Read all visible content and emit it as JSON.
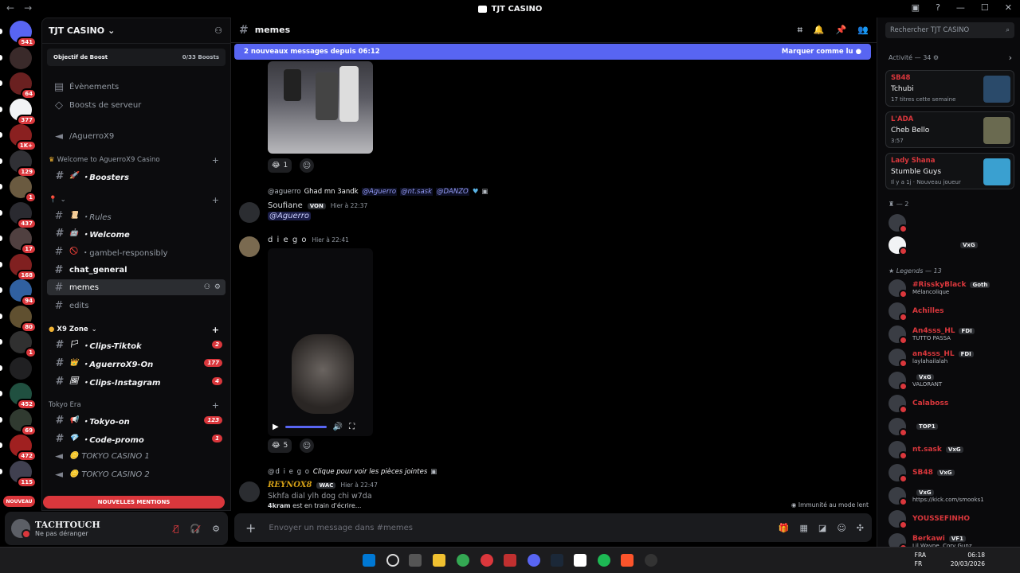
{
  "window": {
    "title": "TJT CASINO",
    "nav_back": "←",
    "nav_fwd": "→"
  },
  "rail": {
    "servers": [
      {
        "badge": "541"
      },
      {
        "badge": ""
      },
      {
        "badge": "64"
      },
      {
        "badge": "377"
      },
      {
        "badge": "1K+"
      },
      {
        "badge": "129"
      },
      {
        "badge": "1"
      },
      {
        "badge": "437"
      },
      {
        "badge": "17"
      },
      {
        "badge": "168"
      },
      {
        "badge": "94"
      },
      {
        "badge": "80"
      },
      {
        "badge": "1"
      },
      {
        "badge": ""
      },
      {
        "badge": "452"
      },
      {
        "badge": "69"
      },
      {
        "badge": "472"
      },
      {
        "badge": "115"
      }
    ],
    "new_label": "NOUVEAU"
  },
  "server": {
    "name": "TJT CASINO",
    "boost_goal": "Objectif de Boost",
    "boost_count": "0/33 Boosts",
    "events": "Évènements",
    "boosts": "Boosts de serveur",
    "voice_top": "/AguerroX9",
    "cat1": "Welcome to AguerroX9 Casino",
    "ch_boosters": "・Boosters",
    "ch_rules": "・Rules",
    "ch_welcome": "・Welcome",
    "ch_gambel": "・gambel-responsibly",
    "ch_chat_general": "chat_general",
    "ch_memes": "memes",
    "ch_edits": "edits",
    "cat2": "X9 Zone",
    "ch_clips_tiktok": "・Clips-Tiktok",
    "ch_clips_tiktok_cnt": "2",
    "ch_aguerro_on": "・AguerroX9-On",
    "ch_aguerro_on_cnt": "177",
    "ch_clips_insta": "・Clips-Instagram",
    "ch_clips_insta_cnt": "4",
    "cat3": "Tokyo Era",
    "ch_tokyo_on": "・Tokyo-on",
    "ch_tokyo_on_cnt": "123",
    "ch_code_promo": "・Code-promo",
    "ch_code_promo_cnt": "1",
    "ch_voice1": "TOKYO CASINO 1",
    "ch_voice2": "TOKYO CASINO 2",
    "new_mentions": "NOUVELLES MENTIONS"
  },
  "user": {
    "name": "TACHTOUCH",
    "status": "Ne pas déranger"
  },
  "chat": {
    "channel": "memes",
    "new_messages": "2 nouveaux messages depuis 06:12",
    "mark_read": "Marquer comme lu",
    "react1_count": "1",
    "reply1_user": "@aguerro",
    "reply1_text": "Ghad mn 3andk",
    "reply1_m1": "@Aguerro",
    "reply1_m2": "@nt.sask",
    "reply1_m3": "@DANZO",
    "msg1_author": "Soufiane",
    "msg1_tag": "VON",
    "msg1_time": "Hier à 22:37",
    "msg1_mention": "@Aguerro",
    "msg2_author": "d i e g o",
    "msg2_time": "Hier à 22:41",
    "react2_count": "5",
    "reply2_user": "@d i e g o",
    "reply2_text": "Clique pour voir les pièces jointes",
    "msg3_author": "REYNOX8",
    "msg3_tag": "WAC",
    "msg3_time": "Hier à 22:47",
    "msg3_text": "Skhfa dial ylh dog chi w7da",
    "typing_user": "4kram",
    "typing_text": "est en train d'écrire...",
    "slow_mode": "Immunité au mode lent",
    "composer_placeholder": "Envoyer un message dans #memes"
  },
  "members": {
    "search_placeholder": "Rechercher TJT CASINO",
    "activity_label": "Activité — 34",
    "activities": [
      {
        "user": "SB48",
        "game": "Tchubi",
        "sub": "17 titres cette semaine",
        "color": "#2a4a6a"
      },
      {
        "user": "L'ADA",
        "game": "Cheb Bello",
        "sub": "3:57",
        "color": "#6a6a50"
      },
      {
        "user": "Lady Shana",
        "game": "Stumble Guys",
        "sub": "Il y a 1j · Nouveau joueur",
        "color": "#3aa0d0"
      }
    ],
    "group1_label": "— 2",
    "group1_tag": "VxG",
    "legends_label": "Legends — 13",
    "list": [
      {
        "name": "#RisskyBlack",
        "sub": "Mélancolique",
        "tag": "Goth"
      },
      {
        "name": "Achilles",
        "sub": "",
        "tag": ""
      },
      {
        "name": "An4sss_HL",
        "sub": "TUTTO PASSA",
        "tag": "FDI"
      },
      {
        "name": "an4sss_HL",
        "sub": "laylahailalah",
        "tag": "FDI"
      },
      {
        "name": "",
        "sub": "VALORANT",
        "tag": "VxG"
      },
      {
        "name": "Calaboss",
        "sub": "",
        "tag": ""
      },
      {
        "name": "",
        "sub": "",
        "tag": "TOP1"
      },
      {
        "name": "nt.sask",
        "sub": "",
        "tag": "VxG"
      },
      {
        "name": "SB48",
        "sub": "",
        "tag": "VxG"
      },
      {
        "name": "",
        "sub": "https://kick.com/smooks1",
        "tag": "VxG"
      },
      {
        "name": "YOUSSEFINHO",
        "sub": "",
        "tag": ""
      },
      {
        "name": "Berkawi",
        "sub": "Lil Wayne, Cory Gunz",
        "tag": "VF1"
      }
    ]
  },
  "taskbar": {
    "lang1": "FRA",
    "lang2": "FR",
    "time": "06:18",
    "date": "20/03/2026"
  }
}
